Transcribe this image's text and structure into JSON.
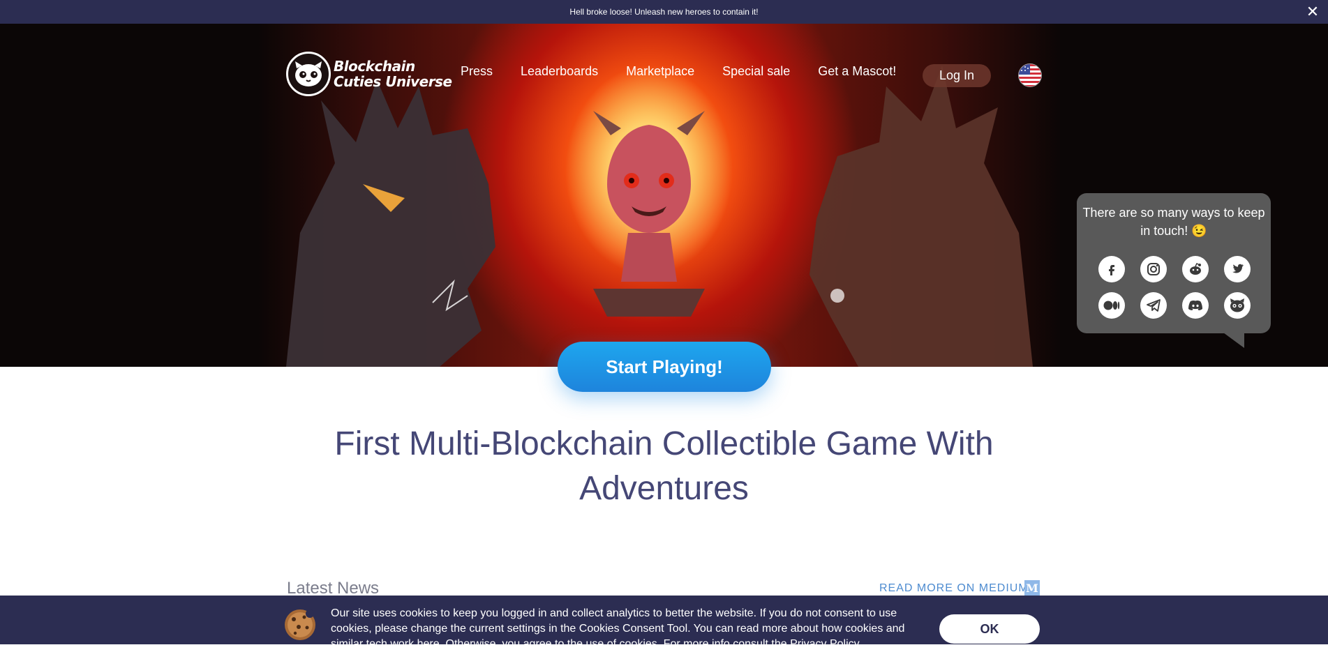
{
  "banner": {
    "text": "Hell broke loose! Unleash new heroes to contain it!",
    "close_glyph": "✕"
  },
  "logo": {
    "line1": "Blockchain",
    "line2": "Cuties Universe"
  },
  "nav": {
    "items": [
      "Press",
      "Leaderboards",
      "Marketplace",
      "Special sale",
      "Get a Mascot!"
    ],
    "login": "Log In"
  },
  "hero": {
    "cta": "Start Playing!"
  },
  "headline": "First Multi-Blockchain Collectible Game With Adventures",
  "news": {
    "title": "Latest News",
    "medium_link": "READ MORE ON MEDIUM",
    "medium_icon_letter": "M"
  },
  "social_popup": {
    "text": "There are so many ways to keep in touch! 😉",
    "icons": [
      "facebook-icon",
      "instagram-icon",
      "reddit-icon",
      "twitter-icon",
      "medium-icon",
      "telegram-icon",
      "discord-icon",
      "cuties-icon"
    ]
  },
  "cookies": {
    "text": "Our site uses cookies to keep you logged in and collect analytics to better the website. If you do not consent to use cookies, please change the current settings in the Cookies Consent Tool. You can read more about how cookies and similar tech work here. Otherwise, you agree to the use of cookies. For more info consult the Privacy Policy.",
    "ok": "OK"
  },
  "colors": {
    "banner_bg": "#2c2d52",
    "cta_blue": "#1e96e6",
    "headline": "#454776",
    "popup_bg": "#595959"
  }
}
